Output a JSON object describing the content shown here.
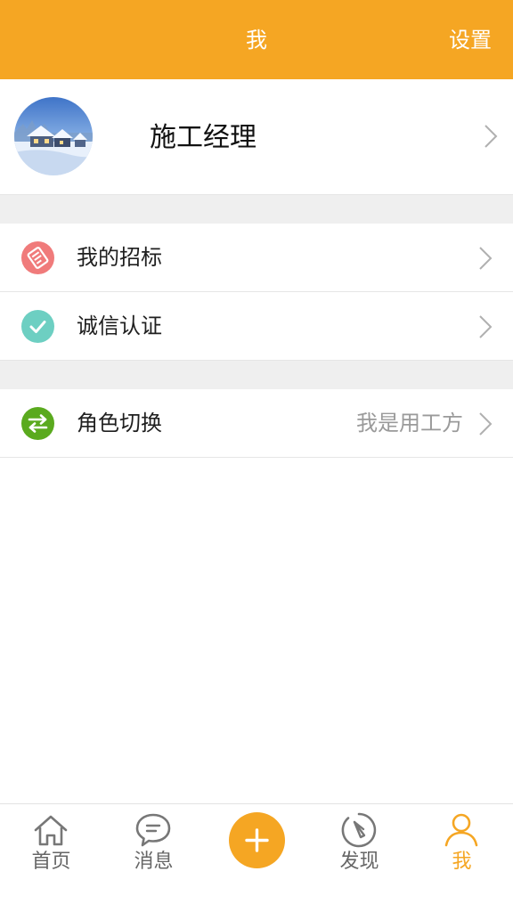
{
  "header": {
    "title": "我",
    "settings_label": "设置"
  },
  "profile": {
    "name": "施工经理"
  },
  "menu": {
    "bids": {
      "label": "我的招标",
      "icon": "bid-document-icon",
      "color": "#f07b7b"
    },
    "certification": {
      "label": "诚信认证",
      "icon": "checkmark-icon",
      "color": "#6dcfc2"
    },
    "role_switch": {
      "label": "角色切换",
      "value": "我是用工方",
      "icon": "swap-arrows-icon",
      "color": "#5aaa1e"
    }
  },
  "tabbar": {
    "home": {
      "label": "首页",
      "icon": "home-icon"
    },
    "messages": {
      "label": "消息",
      "icon": "chat-bubble-icon"
    },
    "add": {
      "icon": "plus-icon"
    },
    "discover": {
      "label": "发现",
      "icon": "compass-icon"
    },
    "me": {
      "label": "我",
      "icon": "person-icon",
      "active": true
    }
  },
  "colors": {
    "accent": "#f5a623",
    "background_gap": "#efefef",
    "secondary_text": "#9a9a9a"
  }
}
